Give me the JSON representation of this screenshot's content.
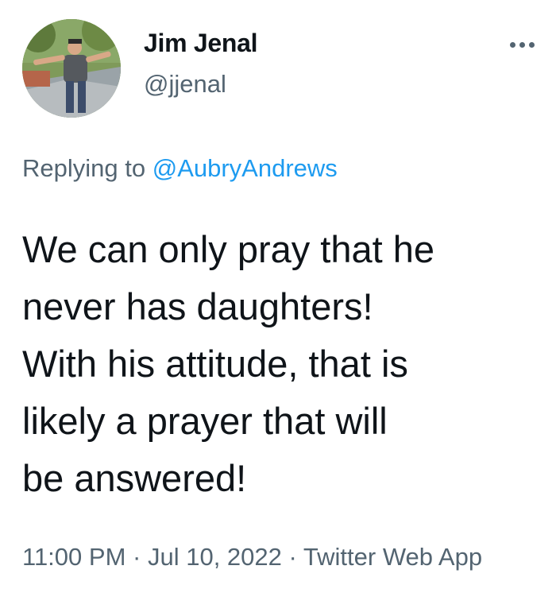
{
  "author": {
    "display_name": "Jim Jenal",
    "handle": "@jjenal"
  },
  "reply": {
    "prefix": "Replying to",
    "mention": "@AubryAndrews"
  },
  "tweet": {
    "lines": [
      "We can only pray that he",
      "never has daughters!",
      "With his attitude, that is",
      "likely a prayer that will",
      "be answered!"
    ]
  },
  "meta": {
    "time": "11:00 PM",
    "date": "Jul 10, 2022",
    "source_line1": "Twitter",
    "source_line2": "Web App",
    "separator": "·"
  },
  "icons": {
    "more": "more-horizontal-icon"
  },
  "colors": {
    "link": "#1d9bf0",
    "secondary": "#536471",
    "text": "#0f1419"
  }
}
